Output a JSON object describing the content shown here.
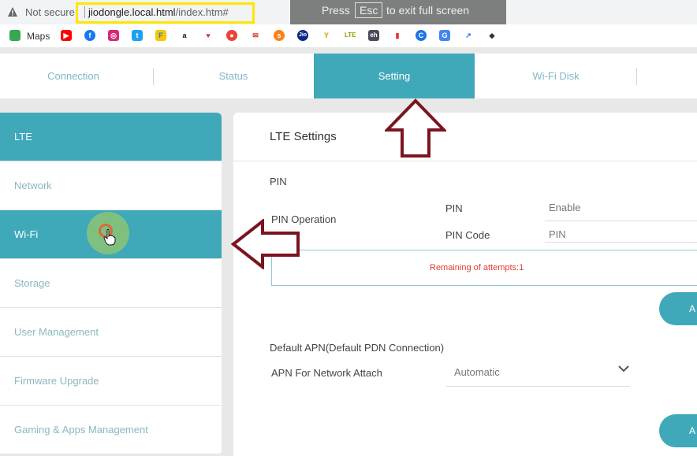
{
  "browser": {
    "security_label": "Not secure",
    "url_host": "jiodongle.local.html",
    "url_path": "/index.htm#",
    "fullscreen_press": "Press",
    "fullscreen_key": "Esc",
    "fullscreen_rest": "to exit full screen",
    "bookmarks": [
      {
        "icon": "google-maps-icon",
        "label": "Maps"
      },
      {
        "icon": "youtube-icon"
      },
      {
        "icon": "facebook-icon"
      },
      {
        "icon": "instagram-icon"
      },
      {
        "icon": "twitter-icon"
      },
      {
        "icon": "flipkart-icon"
      },
      {
        "icon": "amazon-icon"
      },
      {
        "icon": "paytm-icon"
      },
      {
        "icon": "chrome-like-icon"
      },
      {
        "icon": "envelope-icon"
      },
      {
        "icon": "swiggy-icon"
      },
      {
        "icon": "jio-icon"
      },
      {
        "icon": "yellow-tile-icon"
      },
      {
        "icon": "lte-icon"
      },
      {
        "icon": "rh-icon"
      },
      {
        "icon": "bar-chart-icon"
      },
      {
        "icon": "c-icon"
      },
      {
        "icon": "translate-icon"
      },
      {
        "icon": "trend-icon"
      },
      {
        "icon": "layers-icon"
      }
    ]
  },
  "nav": {
    "tabs": [
      "Connection",
      "Status",
      "Setting",
      "Wi-Fi Disk"
    ],
    "active": "Setting"
  },
  "sidebar": {
    "items": [
      "LTE",
      "Network",
      "Wi-Fi",
      "Storage",
      "User Management",
      "Firmware Upgrade",
      "Gaming & Apps Management"
    ]
  },
  "content": {
    "title": "LTE Settings",
    "pin_section": "PIN",
    "pin_operation_label": "PIN Operation",
    "pin_label": "PIN",
    "pin_value": "Enable",
    "pin_code_label": "PIN Code",
    "pin_code_placeholder": "PIN",
    "attempts_text": "Remaining of attempts:1",
    "apply_button_1": "A",
    "apn_section": "Default APN(Default PDN Connection)",
    "apn_label": "APN For Network Attach",
    "apn_value": "Automatic",
    "apply_button_2": "A"
  },
  "colors": {
    "accent": "#3fa9ba",
    "arrow_outline": "#7b1420",
    "error_text": "#e53935",
    "url_highlight": "#ffe600"
  }
}
